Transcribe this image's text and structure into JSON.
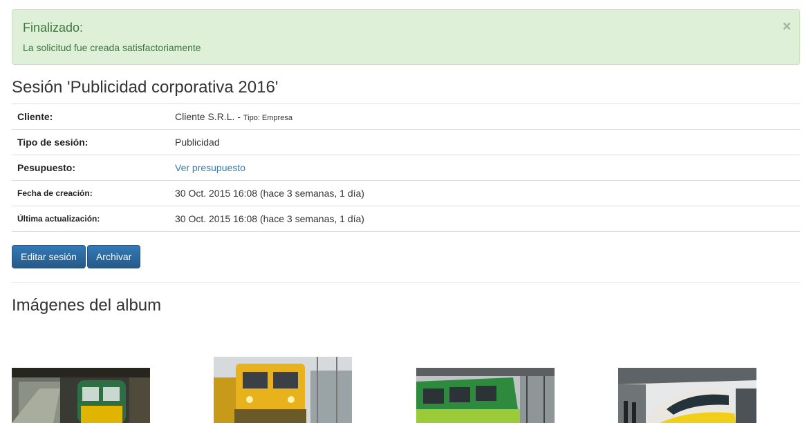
{
  "alert": {
    "title": "Finalizado:",
    "message": "La solicitud fue creada satisfactoriamente",
    "close": "×"
  },
  "session": {
    "title": "Sesión 'Publicidad corporativa 2016'",
    "rows": {
      "client_label": "Cliente:",
      "client_value": "Cliente S.R.L. -",
      "client_type": "Tipo: Empresa",
      "type_label": "Tipo de sesión:",
      "type_value": "Publicidad",
      "budget_label": "Pesupuesto:",
      "budget_link": "Ver presupuesto",
      "created_label": "Fecha de creación:",
      "created_value": "30 Oct. 2015 16:08 (hace 3 semanas, 1 día)",
      "updated_label": "Última actualización:",
      "updated_value": "30 Oct. 2015 16:08 (hace 3 semanas, 1 día)"
    }
  },
  "actions": {
    "edit": "Editar sesión",
    "archive": "Archivar"
  },
  "gallery": {
    "title": "Imágenes del album",
    "images": [
      "train-photo",
      "maintenance-train-photo",
      "green-train-photo",
      "high-speed-train-photo"
    ]
  },
  "colors": {
    "alert_bg": "#dff0d8",
    "alert_text": "#3c763d",
    "link": "#337ab7",
    "button": "#337ab7"
  }
}
